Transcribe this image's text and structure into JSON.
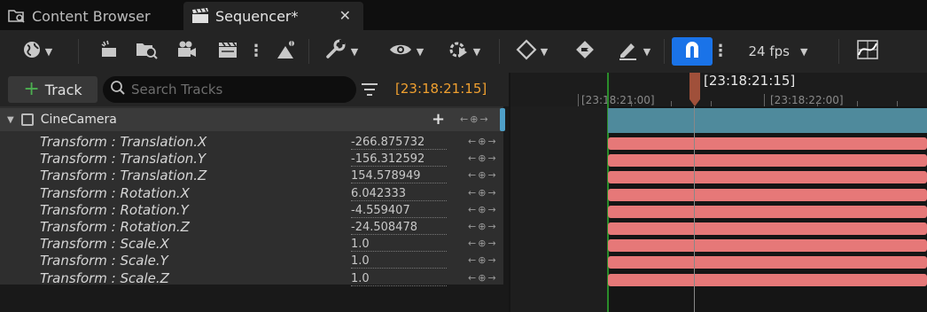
{
  "tabs": [
    {
      "label": "Content Browser",
      "active": false
    },
    {
      "label": "Sequencer*",
      "active": true
    }
  ],
  "toolbar": {
    "fps": "24 fps",
    "snap_active_color": "#1a73e8",
    "icons": [
      "world-icon",
      "render-icon",
      "find-in-browser-icon",
      "camera-icon",
      "clapperboard-icon",
      "more-icon",
      "actor-icon",
      "wrench-icon",
      "eye-icon",
      "playback-icon",
      "key-icon",
      "auto-key-icon",
      "pencil-icon",
      "snap-magnet-icon",
      "curve-editor-icon"
    ]
  },
  "left": {
    "add_track_label": "Track",
    "search_placeholder": "Search Tracks",
    "current_time": "[23:18:21:15]",
    "time_color": "#f0a030"
  },
  "tracks": {
    "camera_label": "CineCamera",
    "properties": [
      {
        "label": "Transform : Translation.X",
        "value": "-266.875732"
      },
      {
        "label": "Transform : Translation.Y",
        "value": "-156.312592"
      },
      {
        "label": "Transform : Translation.Z",
        "value": "154.578949"
      },
      {
        "label": "Transform : Rotation.X",
        "value": "6.042333"
      },
      {
        "label": "Transform : Rotation.Y",
        "value": "-4.559407"
      },
      {
        "label": "Transform : Rotation.Z",
        "value": "-24.508478"
      },
      {
        "label": "Transform : Scale.X",
        "value": "1.0"
      },
      {
        "label": "Transform : Scale.Y",
        "value": "1.0"
      },
      {
        "label": "Transform : Scale.Z",
        "value": "1.0"
      }
    ]
  },
  "timeline": {
    "playhead_label": "[23:18:21:15]",
    "tick_labels": [
      "[23:18:21:00]",
      "[23:18:22:00]"
    ],
    "camera_bar_color": "#4f8a9c",
    "keys_color": "#e67878"
  }
}
